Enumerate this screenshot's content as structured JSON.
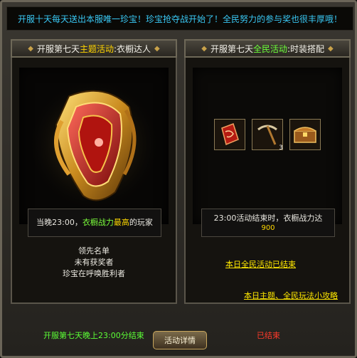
{
  "banner": {
    "text": "开服十天每天送出本服唯一珍宝！珍宝抢夺战开始了！全民努力的参与奖也很丰厚哦！"
  },
  "left_panel": {
    "tab_prefix": "开服第七天",
    "tab_highlight": "主题活动",
    "tab_suffix": ":衣橱达人",
    "info_pre": "当晚23:00，",
    "info_green": "衣橱战力",
    "info_yellow": "最高",
    "info_post": "的玩家",
    "line1": "领先名单",
    "line2": "未有获奖者",
    "line3": "珍宝在呼唤胜利者"
  },
  "right_panel": {
    "tab_prefix": "开服第七天",
    "tab_highlight": "全民活动",
    "tab_suffix": ":时装搭配",
    "info_line1": "23:00活动结束时，衣橱战力达",
    "info_line2": "900",
    "items": [
      {
        "icon": "red-scroll-icon"
      },
      {
        "icon": "pickaxe-icon",
        "count": "3"
      },
      {
        "icon": "treasure-chest-icon"
      }
    ],
    "ended_link": "本日全民活动已结束",
    "guide_link": "本日主题、全民玩法小攻略"
  },
  "footer": {
    "left_text": "开服第七天晚上23:00分结束",
    "button_label": "活动详情",
    "status_text": "已结束"
  },
  "colors": {
    "banner_text": "#39c8f4",
    "highlight_yellow": "#ffd400",
    "highlight_green": "#6cff3a",
    "status_red": "#ff3a2a"
  }
}
